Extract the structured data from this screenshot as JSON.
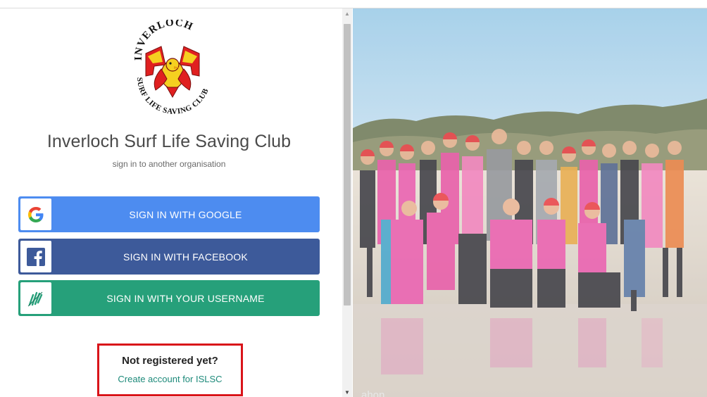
{
  "club": {
    "name": "Inverloch Surf Life Saving Club",
    "subtitle": "sign in to another organisation",
    "logo_text_top": "INVERLOCH",
    "logo_text_bottom": "SURF LIFE SAVING CLUB"
  },
  "signin": {
    "google_label": "SIGN IN WITH GOOGLE",
    "facebook_label": "SIGN IN WITH FACEBOOK",
    "username_label": "SIGN IN WITH YOUR USERNAME",
    "google_icon": "google-g-icon",
    "facebook_icon": "facebook-f-icon",
    "username_icon": "feather-stripes-icon"
  },
  "register": {
    "title": "Not registered yet?",
    "link": "Create account for ISLSC"
  },
  "photo": {
    "credit": "ahon"
  },
  "colors": {
    "google": "#4d8cf0",
    "facebook": "#3d5a9a",
    "username": "#26a07a",
    "highlight": "#d9141a",
    "link": "#1d8a7a"
  }
}
